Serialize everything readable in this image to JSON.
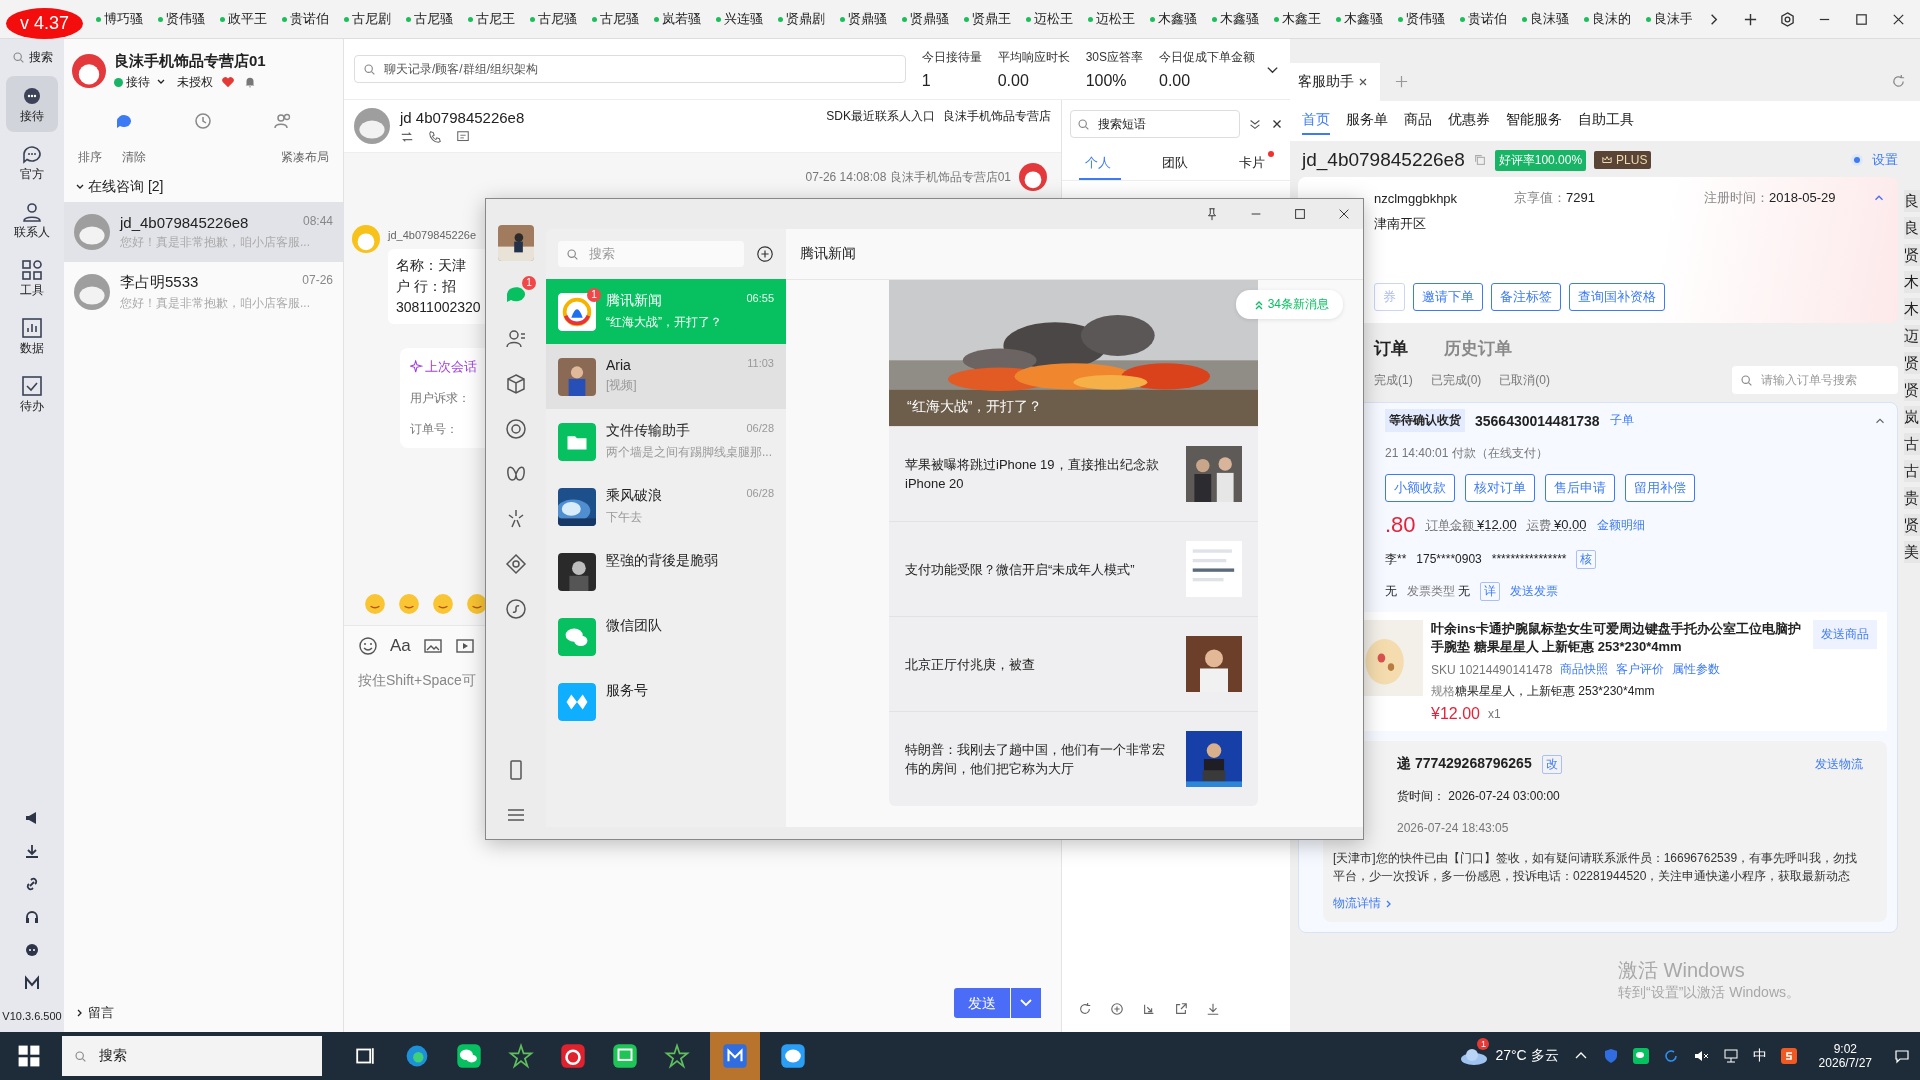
{
  "version_badge": "v 4.37",
  "top_tabs": [
    "博巧骚",
    "贤伟骚",
    "政平王",
    "贵诺伯",
    "古尼剧",
    "古尼骚",
    "古尼王",
    "古尼骚",
    "古尼骚",
    "岚若骚",
    "兴连骚",
    "贤鼎剧",
    "贤鼎骚",
    "贤鼎骚",
    "贤鼎王",
    "迈松王",
    "迈松王",
    "木鑫骚",
    "木鑫骚",
    "木鑫王",
    "木鑫骚",
    "贤伟骚",
    "贵诺伯",
    "良沫骚",
    "良沫的",
    "良沫手"
  ],
  "rail": {
    "search": "搜索",
    "items": [
      {
        "kind": "reception",
        "label": "接待",
        "selected": true
      },
      {
        "kind": "official",
        "label": "官方",
        "selected": false
      },
      {
        "kind": "contacts",
        "label": "联系人",
        "selected": false
      },
      {
        "kind": "tools",
        "label": "工具",
        "selected": false
      },
      {
        "kind": "data",
        "label": "数据",
        "selected": false
      },
      {
        "kind": "todo",
        "label": "待办",
        "selected": false
      }
    ],
    "version": "V10.3.6.500"
  },
  "shop": {
    "name": "良沫手机饰品专营店01",
    "status": "接待",
    "auth": "未授权"
  },
  "list_tabs": [
    {
      "kind": "chat",
      "selected": true
    },
    {
      "kind": "history",
      "selected": false
    },
    {
      "kind": "group",
      "selected": false
    }
  ],
  "list_tools": [
    "排序",
    "清除",
    "紧凑布局"
  ],
  "group": {
    "label": "在线咨询 [2]",
    "expanded": true
  },
  "conversations": [
    {
      "name": "jd_4b079845226e8",
      "time": "08:44",
      "preview": "您好！真是非常抱歉，咱小店客服...",
      "selected": true
    },
    {
      "name": "李占明5533",
      "time": "07-26",
      "preview": "您好！真是非常抱歉，咱小店客服...",
      "selected": false
    }
  ],
  "leave_message": "留言",
  "chat": {
    "search_placeholder": "聊天记录/顾客/群组/组织架构",
    "stats": [
      {
        "label": "今日接待量",
        "value": "1"
      },
      {
        "label": "平均响应时长",
        "value": "0.00"
      },
      {
        "label": "30S应答率",
        "value": "100%"
      },
      {
        "label": "今日促成下单金额",
        "value": "0.00"
      }
    ],
    "contact": "jd 4b079845226e8",
    "sdk_link": "SDK最近联系人入口",
    "shop_link": "良沫手机饰品专营店",
    "timestamp": "07-26 14:08:08",
    "sender": "良沫手机饰品专营店01",
    "customer_id": "jd_4b079845226e",
    "message_lines": [
      "名称：天津",
      "户 行：招",
      "30811002320"
    ],
    "summary_title": "上次会话",
    "summary_fields": [
      "用户诉求：",
      "订单号："
    ],
    "format_label": "Aa",
    "input_placeholder": "按住Shift+Space可",
    "send": "发送"
  },
  "phrases": {
    "search_placeholder": "搜索短语",
    "tabs": [
      {
        "label": "个人",
        "selected": true,
        "dot": false
      },
      {
        "label": "团队",
        "selected": false,
        "dot": false
      },
      {
        "label": "卡片",
        "selected": false,
        "dot": true
      }
    ]
  },
  "assistant": {
    "tab": "客服助手",
    "nav": [
      {
        "label": "首页",
        "selected": true
      },
      {
        "label": "服务单",
        "selected": false
      },
      {
        "label": "商品",
        "selected": false
      },
      {
        "label": "优惠券",
        "selected": false
      },
      {
        "label": "智能服务",
        "selected": false
      },
      {
        "label": "自助工具",
        "selected": false
      }
    ],
    "customer": {
      "id": "jd_4b079845226e8",
      "rating": "好评率100.00%",
      "plus": "PLUS",
      "settings": "设置",
      "account": "nzclmggbkhpk",
      "score_label": "京享值：",
      "score": "7291",
      "reg_label": "注册时间：",
      "reg": "2018-05-29",
      "address": "津南开区",
      "actions": [
        "券",
        "邀请下单",
        "备注标签",
        "查询国补资格"
      ]
    },
    "order_tabs": [
      {
        "label": "订单",
        "selected": true
      },
      {
        "label": "历史订单",
        "selected": false
      }
    ],
    "filters": [
      "完成(1)",
      "已完成(0)",
      "已取消(0)"
    ],
    "order_search_placeholder": "请输入订单号搜索",
    "order": {
      "status": "等待确认收货",
      "number": "3566430014481738",
      "sub": "子单",
      "paid": "21 14:40:01 付款（在线支付）",
      "actions": [
        "小额收款",
        "核对订单",
        "售后申请",
        "留用补偿"
      ],
      "price_part": ".80",
      "total_label": "订单金额",
      "total": "¥12.00",
      "ship_label": "运费",
      "ship": "¥0.00",
      "detail": "金额明细",
      "buyer": "李**",
      "phone": "175****0903",
      "masked": "****************",
      "verify": "核",
      "invoice_value": "无",
      "invoice_type_label": "发票类型",
      "invoice_type": "无",
      "invoice_detail": "详",
      "send_invoice": "发送发票",
      "product": {
        "title": "叶余ins卡通护腕鼠标垫女生可爱周边键盘手托办公室工位电脑护手腕垫 糖果星星人 上新钜惠 253*230*4mm",
        "send": "发送商品",
        "sku_label": "SKU",
        "sku": "10214490141478",
        "links": [
          "商品快照",
          "客户评价",
          "属性参数"
        ],
        "spec_label": "规格",
        "spec": "糖果星星人，上新钜惠 253*230*4mm",
        "price": "¥12.00",
        "qty": "x1"
      },
      "logistics": {
        "title": "递 777429268796265",
        "edit": "改",
        "send": "发送物流",
        "time_label": "货时间：",
        "time": "2026-07-24 03:00:00",
        "event_time": "2026-07-24 18:43:05",
        "event": "[天津市]您的快件已由【门口】签收，如有疑问请联系派件员：16696762539，有事先呼叫我，勿找平台，少一次投诉，多一份感恩，投诉电话：02281944520，关注申通快递小程序，获取最新动态",
        "details": "物流详情"
      }
    }
  },
  "side_strip": [
    "良",
    "良",
    "贤",
    "木",
    "木",
    "迈",
    "贤",
    "贤",
    "岚",
    "古",
    "古",
    "贵",
    "贤",
    "美"
  ],
  "activation": {
    "title": "激活 Windows",
    "hint": "转到“设置”以激活 Windows。"
  },
  "wechat": {
    "search_placeholder": "搜索",
    "rail_badge": "1",
    "header": "腾讯新闻",
    "new_messages": "34条新消息",
    "chats": [
      {
        "name": "腾讯新闻",
        "time": "06:55",
        "preview": "“红海大战”，开打了？",
        "selected": true,
        "hovered": false,
        "badge": "1",
        "kind": "news"
      },
      {
        "name": "Aria",
        "time": "11:03",
        "preview": "[视频]",
        "selected": false,
        "hovered": true
      },
      {
        "name": "文件传输助手",
        "time": "06/28",
        "preview": "两个墙是之间有踢脚线桌腿那...",
        "selected": false,
        "hovered": false,
        "kind": "files"
      },
      {
        "name": "乘风破浪",
        "time": "06/28",
        "preview": "下午去",
        "selected": false,
        "hovered": false,
        "kind": "wave"
      },
      {
        "name": "堅強的背後是脆弱",
        "selected": false,
        "hovered": false
      },
      {
        "name": "微信团队",
        "selected": false,
        "hovered": false,
        "kind": "wechat"
      },
      {
        "name": "服务号",
        "selected": false,
        "hovered": false,
        "kind": "service"
      }
    ],
    "hero_caption": "“红海大战”，开打了？",
    "news": [
      "苹果被曝将跳过iPhone 19，直接推出纪念款iPhone 20",
      "支付功能受限？微信开启“未成年人模式”",
      "北京正厅付兆庚，被查",
      "特朗普：我刚去了趟中国，他们有一个非常宏伟的房间，他们把它称为大厅"
    ]
  },
  "taskbar": {
    "search": "搜索",
    "weather": "27°C 多云",
    "weather_badge": "1",
    "ime": "中",
    "time": "9:02",
    "date": "2026/7/27"
  }
}
